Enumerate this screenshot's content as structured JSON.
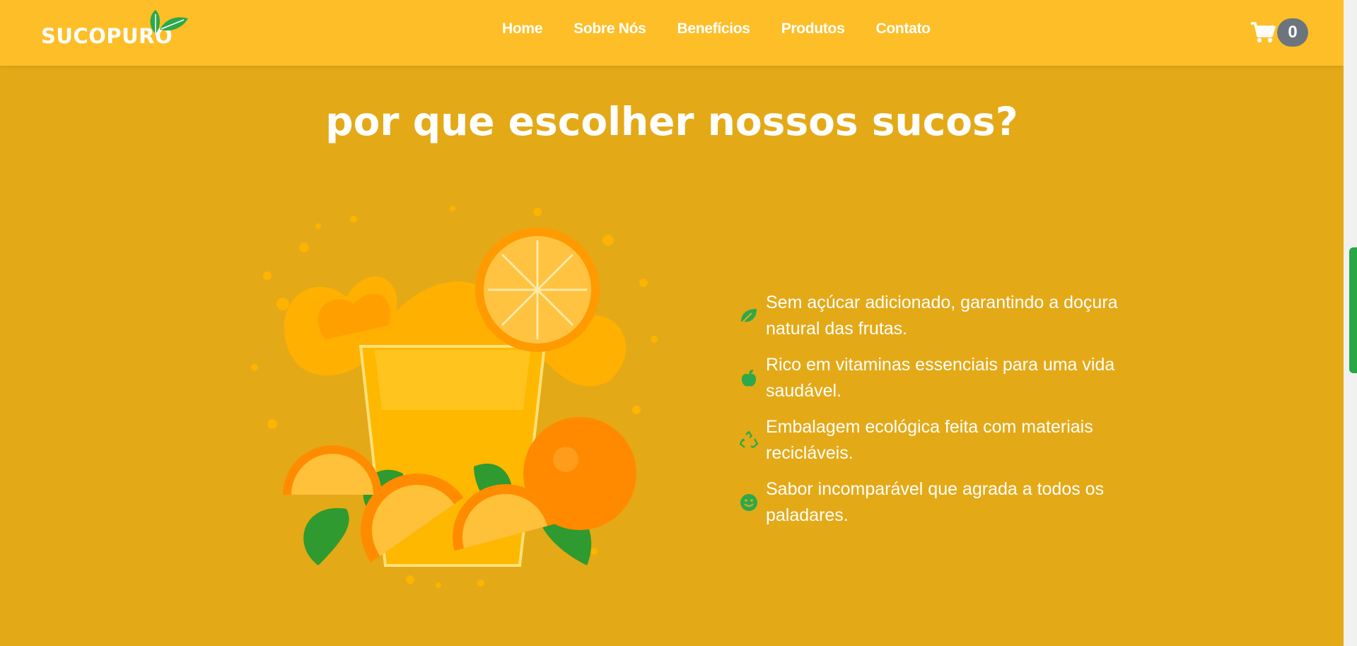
{
  "brand": {
    "name": "SUCOPURO"
  },
  "nav": {
    "links": [
      "Home",
      "Sobre Nós",
      "Benefícios",
      "Produtos",
      "Contato"
    ]
  },
  "cart": {
    "count": "0"
  },
  "section": {
    "title": "Por que escolher nossos sucos?",
    "benefits": [
      {
        "icon": "leaf-icon",
        "text": "Sem açúcar adicionado, garantindo a doçura natural das frutas."
      },
      {
        "icon": "apple-icon",
        "text": "Rico em vitaminas essenciais para uma vida saudável."
      },
      {
        "icon": "recycle-icon",
        "text": "Embalagem ecológica feita com materiais recicláveis."
      },
      {
        "icon": "smile-icon",
        "text": "Sabor incomparável que agrada a todos os paladares."
      }
    ]
  },
  "colors": {
    "navbar": "#FEBE27",
    "background": "#E4A917",
    "accent_green": "#2DA84B",
    "badge": "#6C757D"
  }
}
